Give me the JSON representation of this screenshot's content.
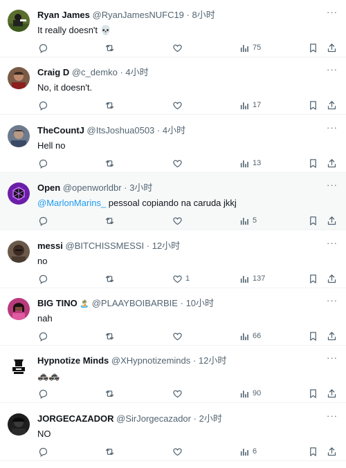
{
  "tweets": [
    {
      "name": "Ryan James",
      "handle": "@RyanJamesNUFC19",
      "time": "8小时",
      "badge": "",
      "text": "It really doesn't 💀",
      "mention": "",
      "likes": "",
      "views": "75"
    },
    {
      "name": "Craig D",
      "handle": "@c_demko",
      "time": "4小时",
      "badge": "",
      "text": "No, it doesn't.",
      "mention": "",
      "likes": "",
      "views": "17"
    },
    {
      "name": "TheCountJ",
      "handle": "@ItsJoshua0503",
      "time": "4小时",
      "badge": "",
      "text": "Hell no",
      "mention": "",
      "likes": "",
      "views": "13"
    },
    {
      "name": "Open",
      "handle": "@openworldbr",
      "time": "3小时",
      "badge": "",
      "text": " pessoal copiando na caruda jkkj",
      "mention": "@MarlonMarins_",
      "likes": "",
      "views": "5"
    },
    {
      "name": "messi",
      "handle": "@BITCHISSMESSI",
      "time": "12小时",
      "badge": "",
      "text": "no",
      "mention": "",
      "likes": "1",
      "views": "137"
    },
    {
      "name": "BIG TINO",
      "handle": "@PLAAYBOIBARBIE",
      "time": "10小时",
      "badge": "🏝️",
      "text": "nah",
      "mention": "",
      "likes": "",
      "views": "66"
    },
    {
      "name": "Hypnotize Minds",
      "handle": "@XHypnotizeminds",
      "time": "12小时",
      "badge": "",
      "text": "🚓🚓",
      "mention": "",
      "likes": "",
      "views": "90"
    },
    {
      "name": "JORGECAZADOR",
      "handle": "@SirJorgecazador",
      "time": "2小时",
      "badge": "",
      "text": "NO",
      "mention": "",
      "likes": "",
      "views": "6"
    }
  ],
  "meta": {
    "separator": "·",
    "more": "···"
  },
  "icons": {
    "reply": "reply-icon",
    "retweet": "retweet-icon",
    "like": "like-icon",
    "views": "views-icon",
    "bookmark": "bookmark-icon",
    "share": "share-icon",
    "more": "more-icon"
  },
  "colors": {
    "mention": "#1d9bf0",
    "secondary": "#536471",
    "highlight_bg": "#f7f9f9",
    "divider": "#eff3f4"
  }
}
